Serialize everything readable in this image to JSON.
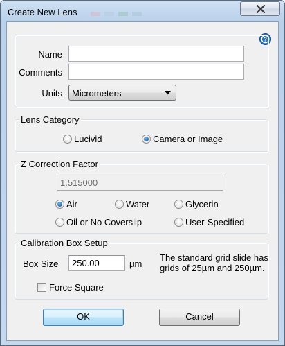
{
  "window": {
    "title": "Create New Lens"
  },
  "lens_info": {
    "name_label": "Name",
    "name_value": "",
    "comments_label": "Comments",
    "comments_value": "",
    "units_label": "Units",
    "units_value": "Micrometers"
  },
  "lens_category": {
    "title": "Lens Category",
    "options": [
      {
        "label": "Lucivid",
        "checked": false
      },
      {
        "label": "Camera or Image",
        "checked": true
      }
    ]
  },
  "z_correction": {
    "title": "Z Correction Factor",
    "value": "1.515000",
    "options": [
      {
        "label": "Air",
        "checked": true
      },
      {
        "label": "Water",
        "checked": false
      },
      {
        "label": "Glycerin",
        "checked": false
      },
      {
        "label": "Oil or No Coverslip",
        "checked": false
      },
      {
        "label": "User-Specified",
        "checked": false
      }
    ]
  },
  "calibration": {
    "title": "Calibration Box Setup",
    "box_size_label": "Box Size",
    "box_size_value": "250.00",
    "unit": "µm",
    "note": "The standard grid slide has grids of 25µm and 250µm.",
    "force_square_label": "Force Square",
    "force_square_checked": false
  },
  "buttons": {
    "ok": "OK",
    "cancel": "Cancel"
  },
  "icons": {
    "close": "close-icon",
    "help": "help-icon",
    "dropdown": "chevron-down-icon"
  }
}
